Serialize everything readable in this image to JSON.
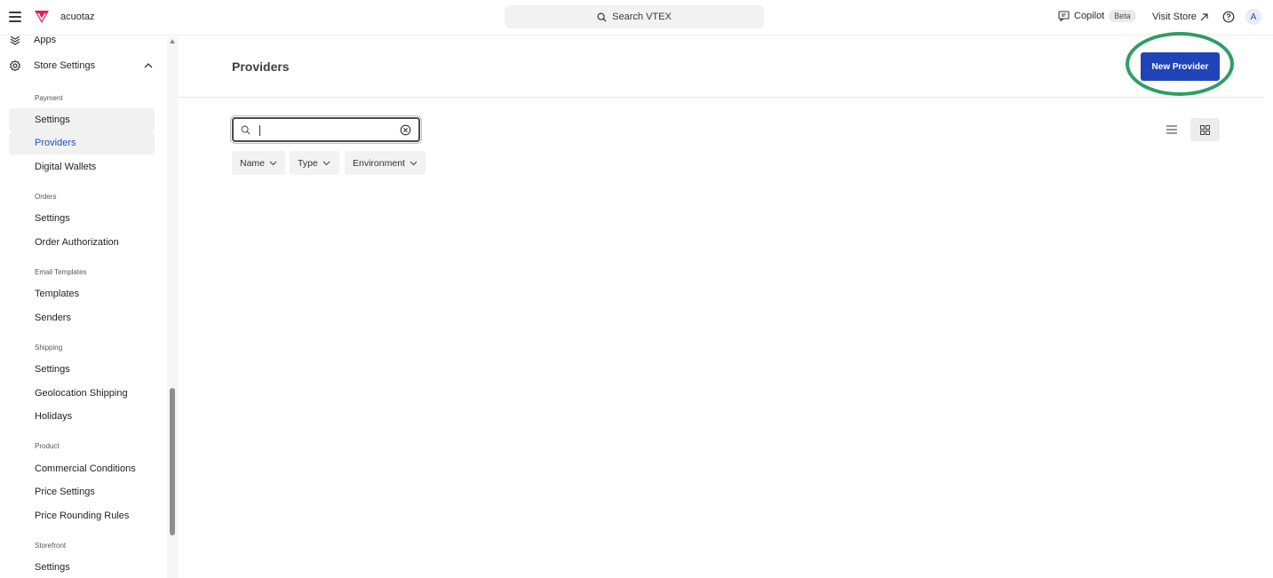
{
  "topbar": {
    "account_name": "acuotaz",
    "search_label": "Search VTEX",
    "copilot_label": "Copilot",
    "beta_label": "Beta",
    "visit_store_label": "Visit Store",
    "avatar_letter": "A"
  },
  "sidebar": {
    "apps_label": "Apps",
    "store_settings_label": "Store Settings",
    "sections": {
      "payment": "Payment",
      "orders": "Orders",
      "email_templates": "Email Templates",
      "shipping": "Shipping",
      "product": "Product",
      "storefront": "Storefront"
    },
    "items": {
      "payment_settings": "Settings",
      "providers": "Providers",
      "digital_wallets": "Digital Wallets",
      "orders_settings": "Settings",
      "order_authorization": "Order Authorization",
      "templates": "Templates",
      "senders": "Senders",
      "shipping_settings": "Settings",
      "geolocation_shipping": "Geolocation Shipping",
      "holidays": "Holidays",
      "commercial_conditions": "Commercial Conditions",
      "price_settings": "Price Settings",
      "price_rounding_rules": "Price Rounding Rules",
      "storefront_settings": "Settings"
    },
    "active_item": "Providers"
  },
  "main": {
    "title": "Providers",
    "new_provider_label": "New Provider",
    "search_value": "",
    "filters": {
      "name": "Name",
      "type": "Type",
      "environment": "Environment"
    },
    "view_mode": "grid"
  },
  "colors": {
    "primary_button": "#1f43b8",
    "active_link": "#2350c7",
    "highlight_ring": "#2e9e64",
    "brand_logo": "#e31c58"
  }
}
